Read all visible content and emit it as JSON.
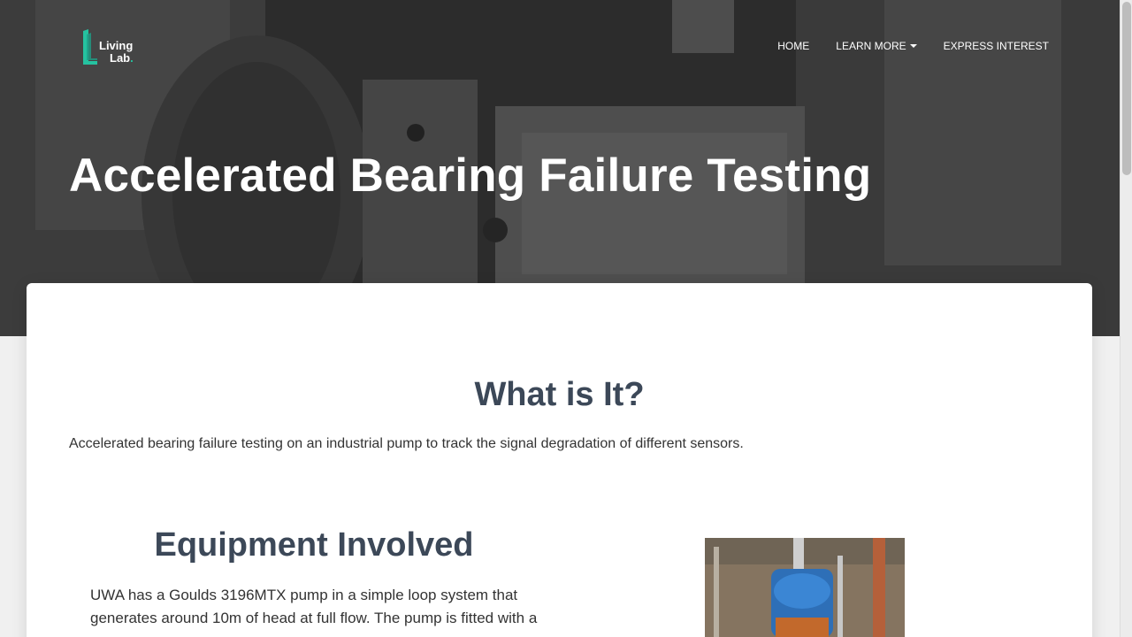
{
  "brand": {
    "name_line1": "Living",
    "name_line2": "Lab",
    "accent": "#25c2a0"
  },
  "nav": {
    "items": [
      {
        "label": "HOME"
      },
      {
        "label": "LEARN MORE",
        "has_dropdown": true
      },
      {
        "label": "EXPRESS INTEREST"
      }
    ]
  },
  "hero": {
    "title": "Accelerated Bearing Failure Testing"
  },
  "what": {
    "heading": "What is It?",
    "text": "Accelerated bearing failure testing on an industrial pump to track the signal degradation of different sensors."
  },
  "equipment": {
    "heading": "Equipment Involved",
    "text": "UWA has a Goulds 3196MTX pump in a simple loop system that generates around 10m of head at full flow. The pump is fitted with a"
  },
  "colors": {
    "heading": "#3c4858",
    "body_text": "#333333",
    "card": "#ffffff"
  }
}
